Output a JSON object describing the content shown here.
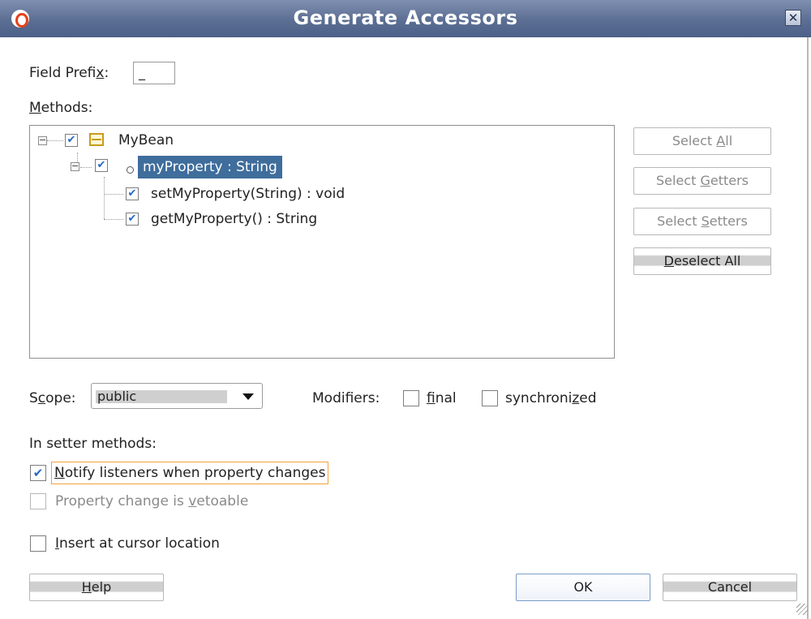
{
  "window": {
    "title": "Generate Accessors",
    "close_icon": "close-icon",
    "logo_icon": "oracle-logo-icon"
  },
  "field_prefix": {
    "label_pre": "Field Prefi",
    "label_mnemonic": "x",
    "label_post": ":",
    "value": "_"
  },
  "methods": {
    "label_mnemonic": "M",
    "label_rest": "ethods:",
    "tree": {
      "root": {
        "label": "MyBean",
        "checked": true,
        "expanded": true
      },
      "property": {
        "label": "myProperty : String",
        "checked": true,
        "expanded": true,
        "selected": true
      },
      "children": [
        {
          "label": "setMyProperty(String) : void",
          "checked": true
        },
        {
          "label": "getMyProperty() : String",
          "checked": true
        }
      ]
    }
  },
  "side_buttons": {
    "select_all": {
      "pre": "Select ",
      "mn": "A",
      "post": "ll"
    },
    "select_getters": {
      "pre": "Select ",
      "mn": "G",
      "post": "etters"
    },
    "select_setters": {
      "pre": "Select ",
      "mn": "S",
      "post": "etters"
    },
    "deselect_all": {
      "pre": "",
      "mn": "D",
      "post": "eselect All"
    }
  },
  "scope": {
    "label_pre": "S",
    "label_mn": "c",
    "label_post": "ope:",
    "value": "public"
  },
  "modifiers": {
    "label": "Modifiers:",
    "final": {
      "pre": "",
      "mn": "f",
      "post": "inal",
      "checked": false
    },
    "synchronized": {
      "pre": "synchroni",
      "mn": "z",
      "post": "ed",
      "checked": false
    }
  },
  "setter_methods": {
    "label": "In setter methods:",
    "notify": {
      "pre": "",
      "mn": "N",
      "post": "otify listeners when property changes",
      "checked": true
    },
    "vetoable": {
      "pre": "Property change is ",
      "mn": "v",
      "post": "etoable",
      "checked": false
    }
  },
  "insert_cursor": {
    "pre": "",
    "mn": "I",
    "post": "nsert at cursor location",
    "checked": false
  },
  "footer": {
    "help": {
      "pre": "",
      "mn": "H",
      "post": "elp"
    },
    "ok": "OK",
    "cancel": "Cancel"
  }
}
